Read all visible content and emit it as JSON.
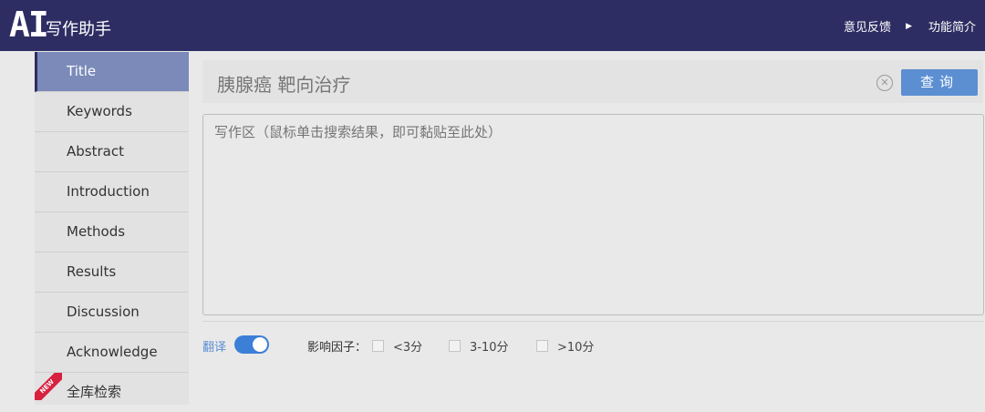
{
  "header": {
    "logo_mark": "AI",
    "app_title": "写作助手",
    "links": [
      "意见反馈",
      "功能简介"
    ]
  },
  "sidebar": {
    "items": [
      {
        "label": "Title",
        "active": true
      },
      {
        "label": "Keywords"
      },
      {
        "label": "Abstract"
      },
      {
        "label": "Introduction"
      },
      {
        "label": "Methods"
      },
      {
        "label": "Results"
      },
      {
        "label": "Discussion"
      },
      {
        "label": "Acknowledge"
      },
      {
        "label": "全库检索",
        "badge": "NEW"
      }
    ]
  },
  "search": {
    "value": "胰腺癌 靶向治疗",
    "button_label": "查询"
  },
  "writing_area": {
    "placeholder": "写作区（鼠标单击搜索结果，即可黏贴至此处）"
  },
  "controls": {
    "translate_label": "翻译",
    "translate_on": true,
    "impact_factor_label": "影响因子：",
    "options": [
      "<3分",
      "3-10分",
      ">10分"
    ]
  },
  "colors": {
    "header_bg": "#2e2d63",
    "active_item": "#7b8ab9",
    "accent": "#5b8fd2",
    "badge": "#d8203f"
  }
}
